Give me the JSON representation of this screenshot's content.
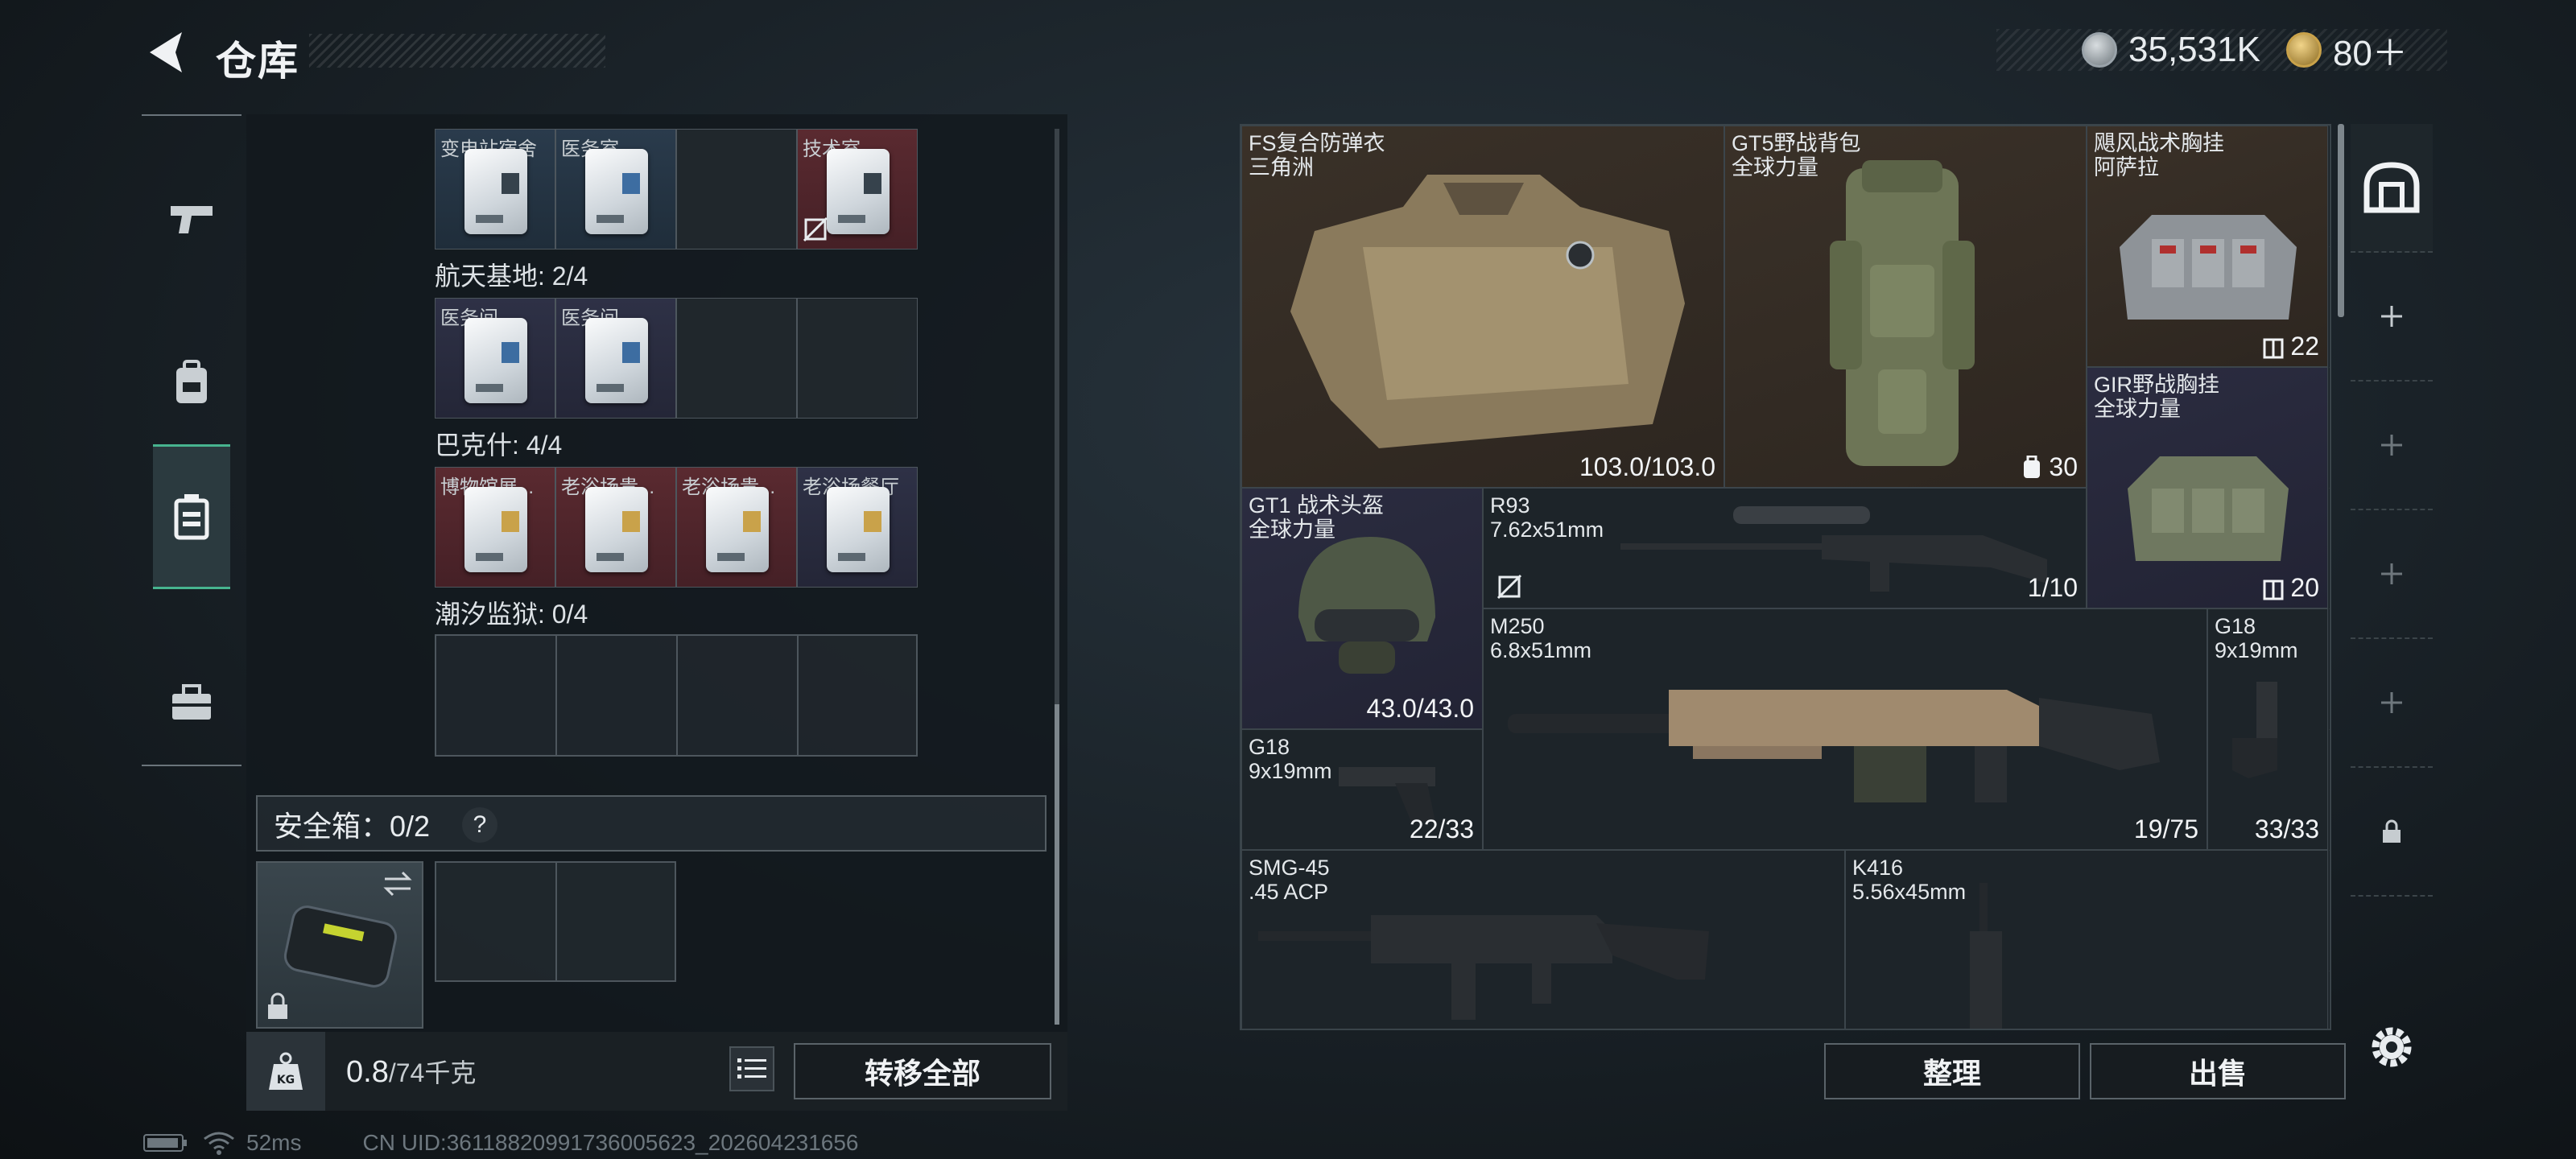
{
  "header": {
    "title": "仓库",
    "back_icon": "back-arrow-icon"
  },
  "currency": [
    {
      "icon": "silver-coin-icon",
      "value": "35,531K",
      "color": "#9aa3aa"
    },
    {
      "icon": "gold-coin-icon",
      "value": "80＋",
      "color": "#c9a24a"
    }
  ],
  "left_tabs": [
    {
      "icon": "pistol-icon",
      "active": false
    },
    {
      "icon": "backpack-icon",
      "active": false
    },
    {
      "icon": "container-icon",
      "active": true
    },
    {
      "icon": "toolbox-icon",
      "active": false
    }
  ],
  "keycards": {
    "row0": [
      {
        "label": "变电站宿舍",
        "color": "blue"
      },
      {
        "label": "医务室",
        "color": "blue"
      },
      {
        "label": "",
        "color": "empty"
      },
      {
        "label": "技术室",
        "color": "red"
      }
    ],
    "groups": [
      {
        "title": "航天基地: 2/4",
        "slots": [
          {
            "label": "医务间",
            "color": "purple"
          },
          {
            "label": "医务间",
            "color": "purple"
          },
          {
            "label": "",
            "color": "empty"
          },
          {
            "label": "",
            "color": "empty"
          }
        ]
      },
      {
        "title": "巴克什: 4/4",
        "slots": [
          {
            "label": "博物馆展...",
            "color": "red"
          },
          {
            "label": "老浴场贵...",
            "color": "red"
          },
          {
            "label": "老浴场贵...",
            "color": "red"
          },
          {
            "label": "老浴场餐厅",
            "color": "purple"
          }
        ]
      },
      {
        "title": "潮汐监狱: 0/4",
        "slots": []
      }
    ]
  },
  "safebox": {
    "label": "安全箱：0/2",
    "help": "?"
  },
  "weight": {
    "current": "0.8",
    "max": "/74千克",
    "icon": "kg-weight-icon"
  },
  "buttons": {
    "transfer_all": "转移全部",
    "organize": "整理",
    "sell": "出售"
  },
  "status": {
    "ping": "52ms",
    "uid": "CN UID:36118820991736005623_202604231656"
  },
  "items": [
    {
      "name": "FS复合防弹衣",
      "sub": "三角洲",
      "value": "103.0/103.0"
    },
    {
      "name": "GT5野战背包",
      "sub": "全球力量",
      "value": "30",
      "value_icon": "backpack-capacity-icon"
    },
    {
      "name": "飓风战术胸挂",
      "sub": "阿萨拉",
      "value": "22",
      "value_icon": "rig-capacity-icon"
    },
    {
      "name": "GIR野战胸挂",
      "sub": "全球力量",
      "value": "20",
      "value_icon": "rig-capacity-icon"
    },
    {
      "name": "GT1 战术头盔",
      "sub": "全球力量",
      "value": "43.0/43.0"
    },
    {
      "name": "R93",
      "sub": "7.62x51mm",
      "value": "1/10"
    },
    {
      "name": "M250",
      "sub": "6.8x51mm",
      "value": "19/75"
    },
    {
      "name": "G18",
      "sub": "9x19mm",
      "value": "33/33"
    },
    {
      "name": "G18",
      "sub": "9x19mm",
      "value": "22/33"
    },
    {
      "name": "SMG-45",
      "sub": ".45 ACP",
      "value": ""
    },
    {
      "name": "K416",
      "sub": "5.56x45mm",
      "value": ""
    }
  ],
  "right_tabs": [
    {
      "icon": "warehouse-icon",
      "active": true
    },
    {
      "icon": "plus-icon"
    },
    {
      "icon": "plus-icon"
    },
    {
      "icon": "plus-icon"
    },
    {
      "icon": "plus-icon"
    },
    {
      "icon": "lock-icon"
    }
  ]
}
